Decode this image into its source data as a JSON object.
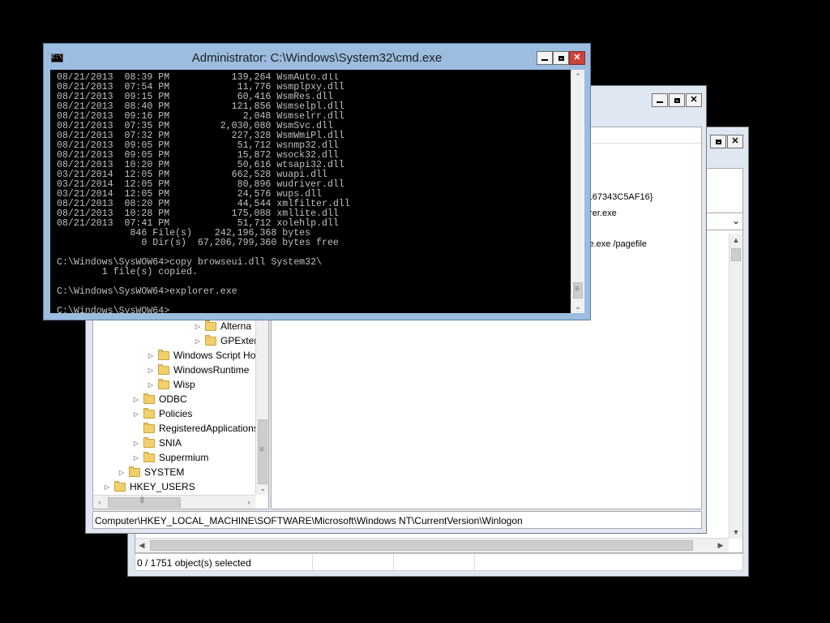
{
  "back_window": {
    "title": "",
    "status": "0 / 1751 object(s) selected"
  },
  "regedit": {
    "title": "",
    "right_fragments": [
      "-167343C5AF16}",
      "orer.exe",
      "ce.exe /pagefile"
    ],
    "statusbar_path": "Computer\\HKEY_LOCAL_MACHINE\\SOFTWARE\\Microsoft\\Windows NT\\CurrentVersion\\Winlogon",
    "tree": [
      {
        "label": "Alterna",
        "expander": "▷"
      },
      {
        "label": "GPExter",
        "expander": "▷"
      },
      {
        "label": "Windows Script Ho",
        "expander": "▷"
      },
      {
        "label": "WindowsRuntime",
        "expander": "▷"
      },
      {
        "label": "Wisp",
        "expander": "▷"
      },
      {
        "label": "ODBC",
        "expander": "▷"
      },
      {
        "label": "Policies",
        "expander": "▷"
      },
      {
        "label": "RegisteredApplications",
        "expander": ""
      },
      {
        "label": "SNIA",
        "expander": "▷"
      },
      {
        "label": "Supermium",
        "expander": "▷"
      },
      {
        "label": "SYSTEM",
        "expander": "▷"
      },
      {
        "label": "HKEY_USERS",
        "expander": "▷"
      }
    ]
  },
  "cmd": {
    "title": "Administrator: C:\\Windows\\System32\\cmd.exe",
    "icon_label": "C:\\",
    "lines": [
      "08/21/2013  08:39 PM           139,264 WsmAuto.dll",
      "08/21/2013  07:54 PM            11,776 wsmplpxy.dll",
      "08/21/2013  09:15 PM            60,416 WsmRes.dll",
      "08/21/2013  08:40 PM           121,856 Wsmselpl.dll",
      "08/21/2013  09:16 PM             2,048 Wsmselrr.dll",
      "08/21/2013  07:35 PM         2,030,080 WsmSvc.dll",
      "08/21/2013  07:32 PM           227,328 WsmWmiPl.dll",
      "08/21/2013  09:05 PM            51,712 wsnmp32.dll",
      "08/21/2013  09:05 PM            15,872 wsock32.dll",
      "08/21/2013  10:20 PM            50,616 wtsapi32.dll",
      "03/21/2014  12:05 PM           662,528 wuapi.dll",
      "03/21/2014  12:05 PM            80,896 wudriver.dll",
      "03/21/2014  12:05 PM            24,576 wups.dll",
      "08/21/2013  08:20 PM            44,544 xmlfilter.dll",
      "08/21/2013  10:28 PM           175,088 xmllite.dll",
      "08/21/2013  07:41 PM            51,712 xolehlp.dll",
      "             846 File(s)    242,196,368 bytes",
      "               0 Dir(s)  67,206,799,360 bytes free",
      "",
      "C:\\Windows\\SysWOW64>copy browseui.dll System32\\",
      "        1 file(s) copied.",
      "",
      "C:\\Windows\\SysWOW64>explorer.exe",
      "",
      "C:\\Windows\\SysWOW64>"
    ]
  },
  "icons": [
    "console-icon",
    "minimize-icon",
    "maximize-icon",
    "close-icon",
    "folder-icon",
    "expand-arrow-icon",
    "scroll-up-icon",
    "scroll-down-icon",
    "scroll-left-icon",
    "scroll-right-icon",
    "grip-icon"
  ],
  "colors": {
    "console_bg": "#000000",
    "console_text": "#c0c0c0",
    "frame": "#dfe8f2",
    "close_button": "#c9433b",
    "folder": "#f1d06c"
  }
}
